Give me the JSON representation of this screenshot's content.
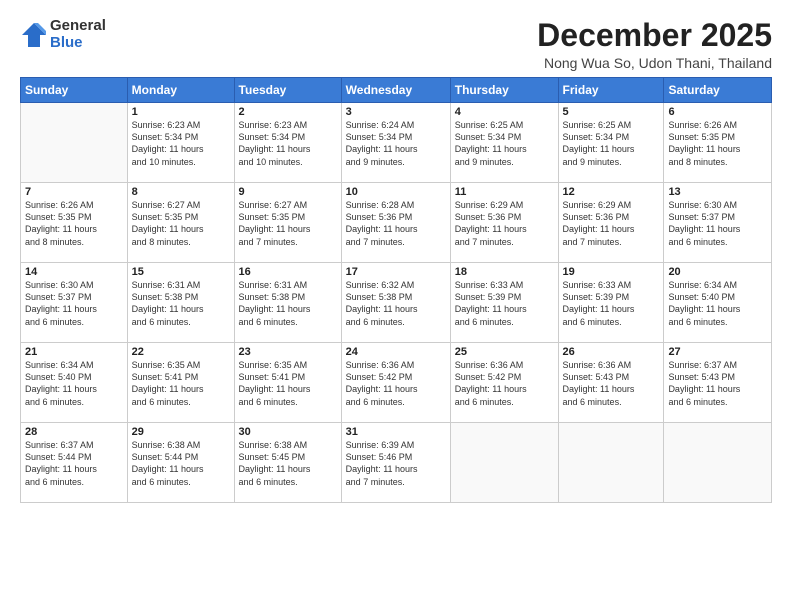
{
  "logo": {
    "general": "General",
    "blue": "Blue"
  },
  "title": "December 2025",
  "subtitle": "Nong Wua So, Udon Thani, Thailand",
  "days_header": [
    "Sunday",
    "Monday",
    "Tuesday",
    "Wednesday",
    "Thursday",
    "Friday",
    "Saturday"
  ],
  "weeks": [
    [
      {
        "day": "",
        "info": ""
      },
      {
        "day": "1",
        "info": "Sunrise: 6:23 AM\nSunset: 5:34 PM\nDaylight: 11 hours\nand 10 minutes."
      },
      {
        "day": "2",
        "info": "Sunrise: 6:23 AM\nSunset: 5:34 PM\nDaylight: 11 hours\nand 10 minutes."
      },
      {
        "day": "3",
        "info": "Sunrise: 6:24 AM\nSunset: 5:34 PM\nDaylight: 11 hours\nand 9 minutes."
      },
      {
        "day": "4",
        "info": "Sunrise: 6:25 AM\nSunset: 5:34 PM\nDaylight: 11 hours\nand 9 minutes."
      },
      {
        "day": "5",
        "info": "Sunrise: 6:25 AM\nSunset: 5:34 PM\nDaylight: 11 hours\nand 9 minutes."
      },
      {
        "day": "6",
        "info": "Sunrise: 6:26 AM\nSunset: 5:35 PM\nDaylight: 11 hours\nand 8 minutes."
      }
    ],
    [
      {
        "day": "7",
        "info": "Sunrise: 6:26 AM\nSunset: 5:35 PM\nDaylight: 11 hours\nand 8 minutes."
      },
      {
        "day": "8",
        "info": "Sunrise: 6:27 AM\nSunset: 5:35 PM\nDaylight: 11 hours\nand 8 minutes."
      },
      {
        "day": "9",
        "info": "Sunrise: 6:27 AM\nSunset: 5:35 PM\nDaylight: 11 hours\nand 7 minutes."
      },
      {
        "day": "10",
        "info": "Sunrise: 6:28 AM\nSunset: 5:36 PM\nDaylight: 11 hours\nand 7 minutes."
      },
      {
        "day": "11",
        "info": "Sunrise: 6:29 AM\nSunset: 5:36 PM\nDaylight: 11 hours\nand 7 minutes."
      },
      {
        "day": "12",
        "info": "Sunrise: 6:29 AM\nSunset: 5:36 PM\nDaylight: 11 hours\nand 7 minutes."
      },
      {
        "day": "13",
        "info": "Sunrise: 6:30 AM\nSunset: 5:37 PM\nDaylight: 11 hours\nand 6 minutes."
      }
    ],
    [
      {
        "day": "14",
        "info": "Sunrise: 6:30 AM\nSunset: 5:37 PM\nDaylight: 11 hours\nand 6 minutes."
      },
      {
        "day": "15",
        "info": "Sunrise: 6:31 AM\nSunset: 5:38 PM\nDaylight: 11 hours\nand 6 minutes."
      },
      {
        "day": "16",
        "info": "Sunrise: 6:31 AM\nSunset: 5:38 PM\nDaylight: 11 hours\nand 6 minutes."
      },
      {
        "day": "17",
        "info": "Sunrise: 6:32 AM\nSunset: 5:38 PM\nDaylight: 11 hours\nand 6 minutes."
      },
      {
        "day": "18",
        "info": "Sunrise: 6:33 AM\nSunset: 5:39 PM\nDaylight: 11 hours\nand 6 minutes."
      },
      {
        "day": "19",
        "info": "Sunrise: 6:33 AM\nSunset: 5:39 PM\nDaylight: 11 hours\nand 6 minutes."
      },
      {
        "day": "20",
        "info": "Sunrise: 6:34 AM\nSunset: 5:40 PM\nDaylight: 11 hours\nand 6 minutes."
      }
    ],
    [
      {
        "day": "21",
        "info": "Sunrise: 6:34 AM\nSunset: 5:40 PM\nDaylight: 11 hours\nand 6 minutes."
      },
      {
        "day": "22",
        "info": "Sunrise: 6:35 AM\nSunset: 5:41 PM\nDaylight: 11 hours\nand 6 minutes."
      },
      {
        "day": "23",
        "info": "Sunrise: 6:35 AM\nSunset: 5:41 PM\nDaylight: 11 hours\nand 6 minutes."
      },
      {
        "day": "24",
        "info": "Sunrise: 6:36 AM\nSunset: 5:42 PM\nDaylight: 11 hours\nand 6 minutes."
      },
      {
        "day": "25",
        "info": "Sunrise: 6:36 AM\nSunset: 5:42 PM\nDaylight: 11 hours\nand 6 minutes."
      },
      {
        "day": "26",
        "info": "Sunrise: 6:36 AM\nSunset: 5:43 PM\nDaylight: 11 hours\nand 6 minutes."
      },
      {
        "day": "27",
        "info": "Sunrise: 6:37 AM\nSunset: 5:43 PM\nDaylight: 11 hours\nand 6 minutes."
      }
    ],
    [
      {
        "day": "28",
        "info": "Sunrise: 6:37 AM\nSunset: 5:44 PM\nDaylight: 11 hours\nand 6 minutes."
      },
      {
        "day": "29",
        "info": "Sunrise: 6:38 AM\nSunset: 5:44 PM\nDaylight: 11 hours\nand 6 minutes."
      },
      {
        "day": "30",
        "info": "Sunrise: 6:38 AM\nSunset: 5:45 PM\nDaylight: 11 hours\nand 6 minutes."
      },
      {
        "day": "31",
        "info": "Sunrise: 6:39 AM\nSunset: 5:46 PM\nDaylight: 11 hours\nand 7 minutes."
      },
      {
        "day": "",
        "info": ""
      },
      {
        "day": "",
        "info": ""
      },
      {
        "day": "",
        "info": ""
      }
    ]
  ]
}
